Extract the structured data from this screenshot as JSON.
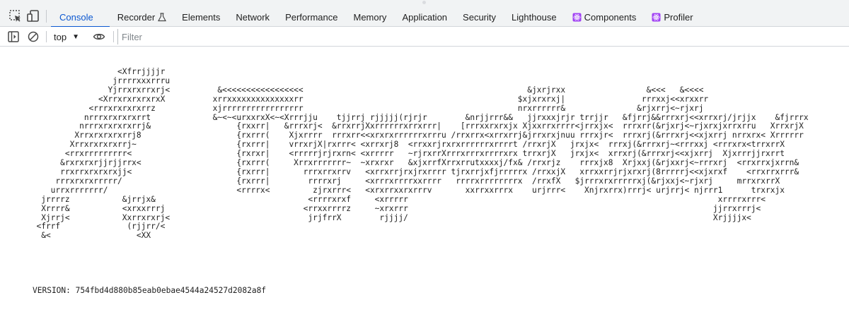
{
  "tabbar": {
    "tabs": [
      {
        "label": "Console",
        "active": true
      },
      {
        "label": "Recorder",
        "icon": "flask-icon"
      },
      {
        "label": "Elements"
      },
      {
        "label": "Network"
      },
      {
        "label": "Performance"
      },
      {
        "label": "Memory"
      },
      {
        "label": "Application"
      },
      {
        "label": "Security"
      },
      {
        "label": "Lighthouse"
      },
      {
        "label": "Components",
        "icon": "react-icon"
      },
      {
        "label": "Profiler",
        "icon": "react-icon"
      }
    ]
  },
  "toolbar": {
    "context": "top",
    "filter_placeholder": "Filter"
  },
  "console": {
    "ascii_art": "                   <Xfrrjjjjr\n                  jrrrrxxxrrru\n                 Yjrrxrxrrxrj<          &<<<<<<<<<<<<<<<<<                                               &jxrjrxx                 &<<<   &<<<<\n               <XrrxrxrxrxrxX          xrrxxxxxxxxxxxxxxrr                                             $xjxrxrxj|                rrrxxj<<xrxxrr\n             <rrrxrxrxrxrrz            xjrrrrrrrrrrrrrrrrr                                             nrxrrrrrr&               &rjxrrj<~rjxrj\n            nrrrxrxrxrxrrt             &~<~<urxxrxX<~<Xrrrjju    tjjrrj rjjjjj(rjrjr        &nrjjrrr&&   jjrxxxjrjr trrjjr   &fjrrj&&rrrxrj<<xrrxrj/jrjjx    &fjrrrx\n           nrrrxrxrxrxrrj&                  {rxxrr|   &rrrxrj<  &rrxrrjXxrrrrrrxrrxrrr|    [rrrxxrxrxjx Xjxxrrxrrrr<jrrxjx<  rrrxrr(&rjxrj<~rjxrxjxrrxrru   XrrxrjX\n          Xrrxrxrxrxrrj8                    {rxrrr(    Xjxrrrr  rrrxrr<<xrxrxrrrrrrxrrru /rrxrrx<xrrxrrj&jrrxrxjnuu rrrxjr<  rrrxrj(&rrrxrj<<xjxrrj nrrxrx< Xrrrrrr\n         Xrrxrxrxrxrrj~                     {rxrrr|    vrrxrjX|rxrrr< <xrrxrj8  <rrxxrjrxrxrrrrrrxrrrrt /rrxrjX   jrxjx<  rrrxj(&rrrxrj~<rrrxxj <rrrxrx<trrxrrX\n        <rrxrrrrrrrrr<                      {rxrxr|    <rrrrrjrjrxrn< <xrrrrr   ~rjrxrrXrrrxrrrxrrrrxrx trrxrjX   jrxjx<  xrrxrj(&rrrxrj<<xjxrrj  Xjxrrrjjrxrrt\n       &rxrxrxrjjrjjrrx<                    {rxrrr(     Xrrxrrrrrrr~  ~xrxrxr   &xjxrrfXrrxrrutxxxxj/fx& /rrxrjz    rrrxjx8  Xrjxxj(&rjxxrj<~rrrxrj  <rrxrrxjxrrn&\n       rrxrrxrxrxrxjj<                      {rxrrr|       rrrxrrxrrv   <xrrxrrjrxjrxrrrr tjrxrrjxfjrrrrrx /rrxxjX   xrrxxrrjrjxrxrj(8rrrrrj<<xjxrxf    <rrxrrxrrr&\n      rrrxrxrxrrrrr/                        {rxrrr|        rrrrxrj     <xrrrxrrrrxxrrrr   rrrrxrrrrrrrrx  /rrxfX   $jrrrxrxrrrrrxj(&rjxxj<~rjxrj     mrrxrxrrX\n     urrxrrrrrrr/                           <rrrrx<         zjrxrrr<   <xrxrrxxrxrrrv       xxrrxxrrrx    urjrrr<    Xnjrxrrx)rrrj< urjrrj< njrrr1      trxrxjx\n   jrrrrz           &jrrjx&                                <rrrrxrxf     <xrrrrr                                                                 xrrrrxrrr<\n   Xrrrr&           <xrxxrrrj                             <rrxxrrrrz     ~xrxrrr                                                                jjrrxrrrj<\n   Xjrrj<           Xxrrxrxrj<                             jrjfrrX        rjjjj/                                                                Xrjjjjx<\n  <frrf              (rjjrr/<\n   &<                  <XX",
    "version": "VERSION: 754fbd4d880b85eab0ebae4544a24527d2082a8f"
  },
  "colors": {
    "accent": "#0b57d0",
    "tab_bar_bg": "#f1f3f4",
    "react_icon": "#a142f4"
  }
}
